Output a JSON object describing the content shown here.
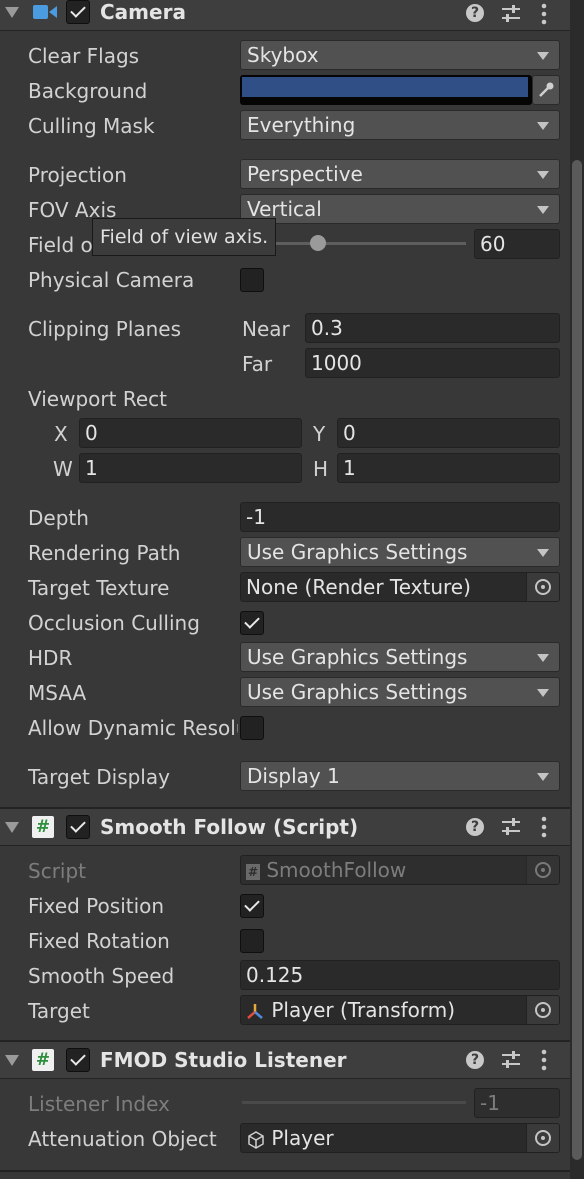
{
  "camera": {
    "title": "Camera",
    "enabled": true,
    "clear_flags": {
      "label": "Clear Flags",
      "value": "Skybox"
    },
    "background": {
      "label": "Background",
      "color": "#2f4f86"
    },
    "culling_mask": {
      "label": "Culling Mask",
      "value": "Everything"
    },
    "projection": {
      "label": "Projection",
      "value": "Perspective"
    },
    "fov_axis": {
      "label": "FOV Axis",
      "value": "Vertical"
    },
    "field_of_view": {
      "label": "Field o",
      "value": "60",
      "slider_fraction": 0.333
    },
    "physical_camera": {
      "label": "Physical Camera",
      "checked": false
    },
    "clipping_planes": {
      "label": "Clipping Planes",
      "near_label": "Near",
      "near": "0.3",
      "far_label": "Far",
      "far": "1000"
    },
    "viewport_rect": {
      "label": "Viewport Rect",
      "x_label": "X",
      "x": "0",
      "y_label": "Y",
      "y": "0",
      "w_label": "W",
      "w": "1",
      "h_label": "H",
      "h": "1"
    },
    "depth": {
      "label": "Depth",
      "value": "-1"
    },
    "rendering_path": {
      "label": "Rendering Path",
      "value": "Use Graphics Settings"
    },
    "target_texture": {
      "label": "Target Texture",
      "value": "None (Render Texture)"
    },
    "occlusion_culling": {
      "label": "Occlusion Culling",
      "checked": true
    },
    "hdr": {
      "label": "HDR",
      "value": "Use Graphics Settings"
    },
    "msaa": {
      "label": "MSAA",
      "value": "Use Graphics Settings"
    },
    "allow_dynamic_resolution": {
      "label": "Allow Dynamic Resolu",
      "checked": false
    },
    "target_display": {
      "label": "Target Display",
      "value": "Display 1"
    }
  },
  "tooltip": {
    "text": "Field of view axis."
  },
  "smooth_follow": {
    "title": "Smooth Follow (Script)",
    "enabled": true,
    "script": {
      "label": "Script",
      "value": "SmoothFollow"
    },
    "fixed_position": {
      "label": "Fixed Position",
      "checked": true
    },
    "fixed_rotation": {
      "label": "Fixed Rotation",
      "checked": false
    },
    "smooth_speed": {
      "label": "Smooth Speed",
      "value": "0.125"
    },
    "target": {
      "label": "Target",
      "value": "Player (Transform)"
    }
  },
  "fmod_listener": {
    "title": "FMOD Studio Listener",
    "enabled": true,
    "listener_index": {
      "label": "Listener Index",
      "value": "-1"
    },
    "attenuation_object": {
      "label": "Attenuation Object",
      "value": "Player"
    }
  },
  "icons": {
    "camera": "video-camera-icon",
    "script": "script-hash-icon",
    "help": "help-icon",
    "presets": "sliders-icon",
    "menu": "kebab-menu-icon",
    "eyedropper": "eyedropper-icon",
    "object_picker": "object-picker-icon",
    "transform": "transform-axes-icon",
    "gameobject": "cube-icon"
  },
  "colors": {
    "panel": "#383838",
    "header": "#3e3e3e",
    "field": "#2a2a2a",
    "dropdown": "#515151",
    "accent_camera": "#4a9be0"
  }
}
